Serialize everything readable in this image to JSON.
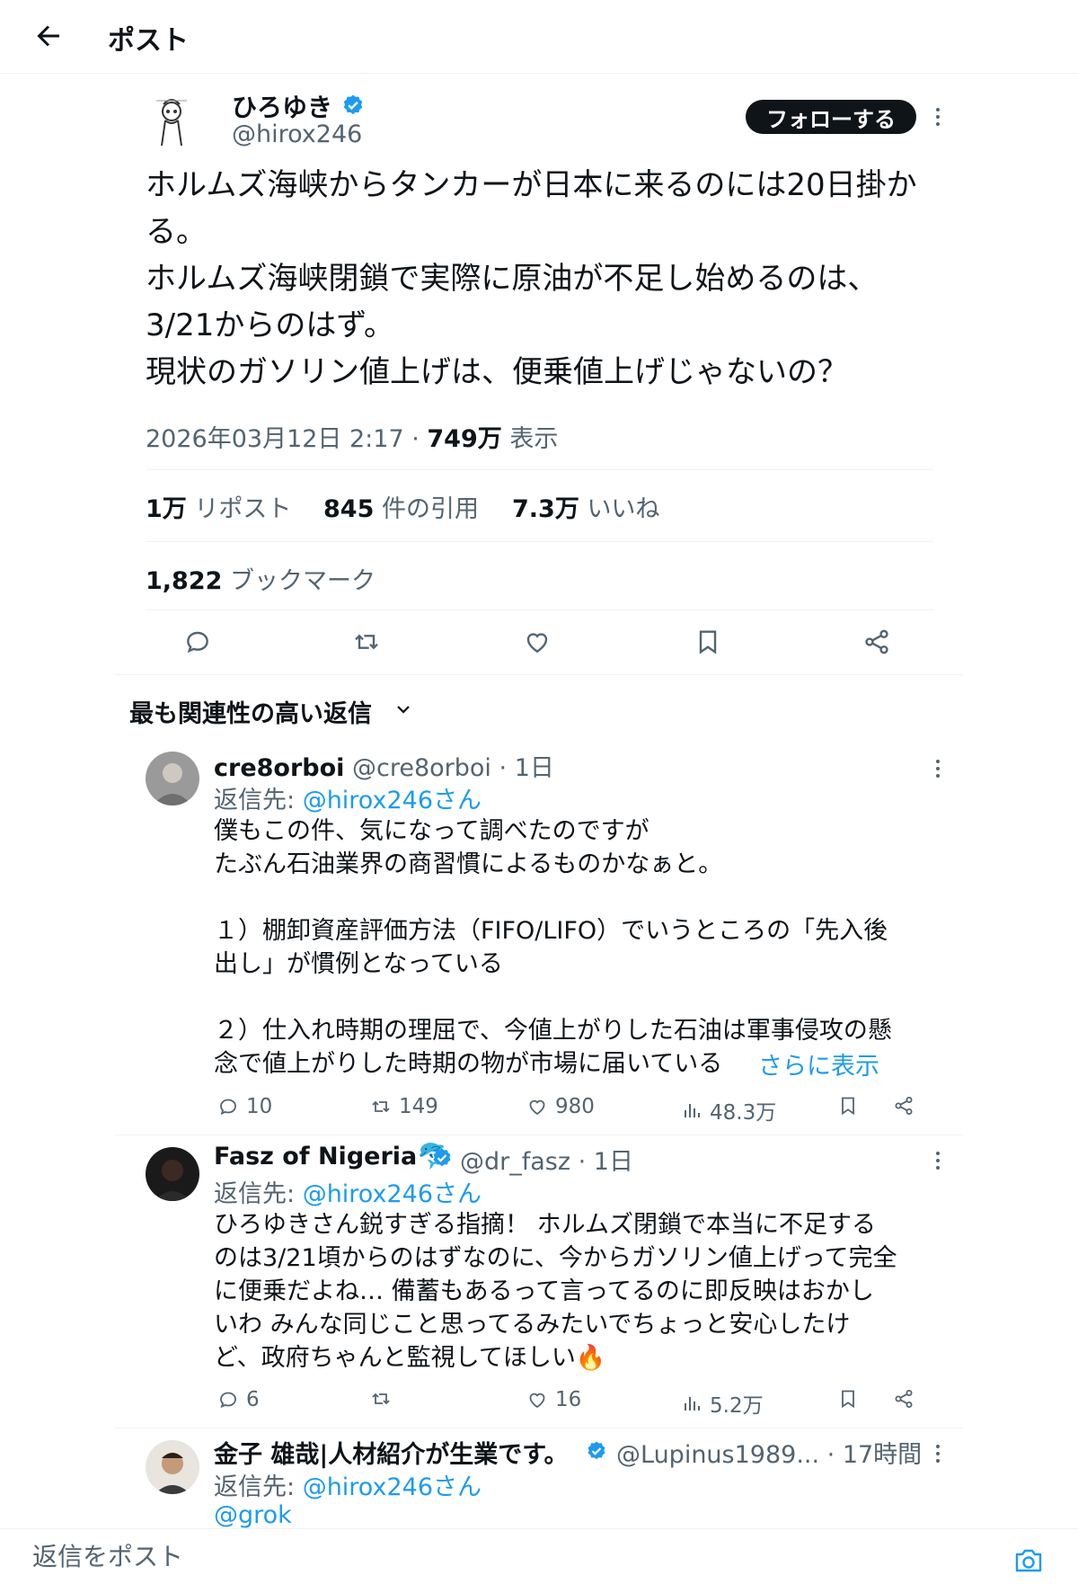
{
  "header": {
    "title": "ポスト"
  },
  "post": {
    "author_name": "ひろゆき",
    "author_handle": "@hirox246",
    "follow_label": "フォローする",
    "text": "ホルムズ海峡からタンカーが日本に来るのには20日掛か\nる。\nホルムズ海峡閉鎖で実際に原油が不足し始めるのは、\n3/21からのはず。\n現状のガソリン値上げは、便乗値上げじゃないの？",
    "timestamp": "2026年03月12日 2:17",
    "views_count": "749万",
    "views_label": "表示",
    "reposts_count": "1万",
    "reposts_label": "リポスト",
    "quotes_count": "845",
    "quotes_label": "件の引用",
    "likes_count": "7.3万",
    "likes_label": "いいね",
    "bookmarks_count": "1,822",
    "bookmarks_label": "ブックマーク"
  },
  "sort": {
    "label": "最も関連性の高い返信"
  },
  "replies": [
    {
      "name": "cre8orboi",
      "handle": "@cre8orboi",
      "time": "1日",
      "reply_to_prefix": "返信先: ",
      "reply_to": "@hirox246さん",
      "text": "僕もこの件、気になって調べたのですが\nたぶん石油業界の商習慣によるものかなぁと。\n\n１）棚卸資産評価方法（FIFO/LIFO）でいうところの「先入後\n出し」が慣例となっている\n\n２）仕入れ時期の理屈で、今値上がりした石油は軍事侵攻の懸\n念で値上がりした時期の物が市場に届いている",
      "show_more": "さらに表示",
      "replies_count": "10",
      "reposts_count": "149",
      "likes_count": "980",
      "views_count": "48.3万"
    },
    {
      "name": "Fasz of Nigeria",
      "handle": "@dr_fasz",
      "time": "1日",
      "reply_to_prefix": "返信先: ",
      "reply_to": "@hirox246さん",
      "text": "ひろゆきさん鋭すぎる指摘！ ホルムズ閉鎖で本当に不足する\nのは3/21頃からのはずなのに、今からガソリン値上げって完全\nに便乗だよね… 備蓄もあるって言ってるのに即反映はおかし\nいわ みんな同じこと思ってるみたいでちょっと安心したけ\nど、政府ちゃんと監視してほしい🔥",
      "replies_count": "6",
      "likes_count": "16",
      "views_count": "5.2万"
    },
    {
      "name": "金子 雄哉|人材紹介が生業です。",
      "handle": "@Lupinus1989...",
      "time": "17時間",
      "reply_to_prefix": "返信先: ",
      "reply_to": "@hirox246さん",
      "text": "@grok"
    }
  ],
  "composer": {
    "placeholder": "返信をポスト"
  },
  "colors": {
    "accent": "#1d9bf0",
    "text": "#0f1419",
    "muted": "#536471",
    "border": "#eff3f4"
  }
}
